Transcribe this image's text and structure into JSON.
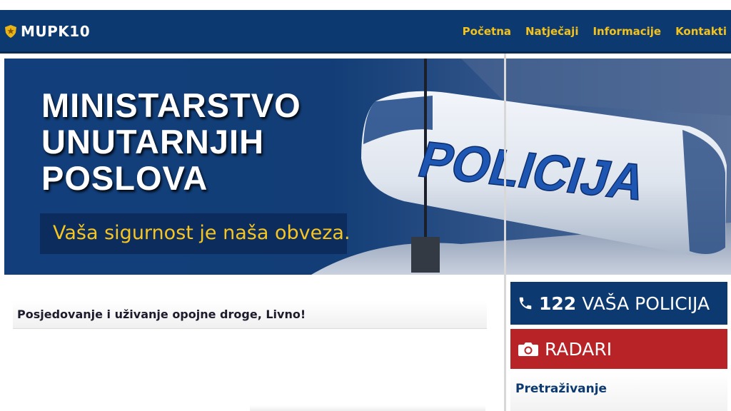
{
  "brand": {
    "name": "MUPK10",
    "icon": "police-badge-icon"
  },
  "nav": {
    "items": [
      "Početna",
      "Natječaji",
      "Informacije",
      "Kontakti"
    ]
  },
  "hero": {
    "title_lines": [
      "MINISTARSTVO",
      "UNUTARNJIH",
      "POSLOVA"
    ],
    "tagline": "Vaša sigurnost je naša obveza.",
    "image_text": "POLICIJA"
  },
  "post": {
    "title": "Posjedovanje i uživanje opojne droge, Livno!"
  },
  "sidebar": {
    "police_button": {
      "icon": "phone-icon",
      "number": "122",
      "label": "VAŠA POLICIJA"
    },
    "radar_button": {
      "icon": "camera-icon",
      "label": "RADARI"
    },
    "search_heading": "Pretraživanje"
  },
  "colors": {
    "navy": "#0c3a70",
    "nav_link": "#f4c21a",
    "tagline": "#f6c51f",
    "radar_red": "#b82327"
  }
}
